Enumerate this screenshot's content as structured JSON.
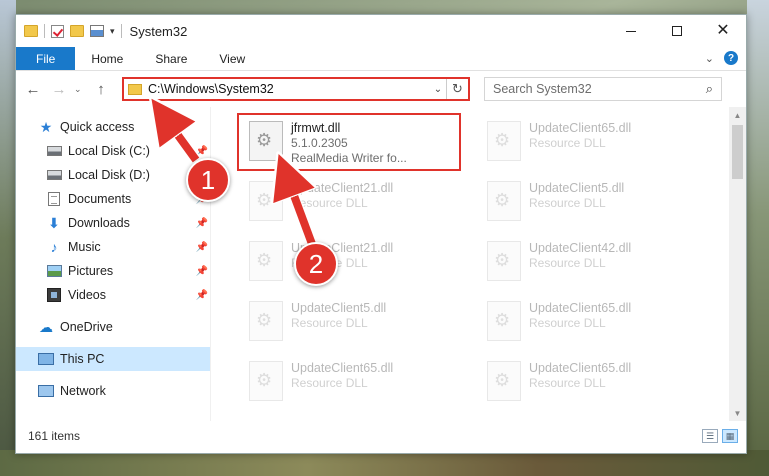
{
  "window": {
    "title": "System32"
  },
  "ribbon": {
    "tabs": [
      "File",
      "Home",
      "Share",
      "View"
    ]
  },
  "nav": {
    "address": "C:\\Windows\\System32",
    "search_placeholder": "Search System32"
  },
  "sidebar": {
    "items": [
      {
        "label": "Quick access",
        "icon": "star-icon"
      },
      {
        "label": "Local Disk (C:)",
        "icon": "disk-icon"
      },
      {
        "label": "Local Disk (D:)",
        "icon": "disk-icon"
      },
      {
        "label": "Documents",
        "icon": "documents-icon"
      },
      {
        "label": "Downloads",
        "icon": "downloads-icon"
      },
      {
        "label": "Music",
        "icon": "music-icon"
      },
      {
        "label": "Pictures",
        "icon": "pictures-icon"
      },
      {
        "label": "Videos",
        "icon": "videos-icon"
      },
      {
        "label": "OneDrive",
        "icon": "cloud-icon"
      },
      {
        "label": "This PC",
        "icon": "pc-icon"
      },
      {
        "label": "Network",
        "icon": "network-icon"
      }
    ]
  },
  "files": {
    "highlighted": {
      "name": "jfrmwt.dll",
      "version": "5.1.0.2305",
      "description": "RealMedia Writer fo..."
    },
    "left_column": [
      {
        "name": "UpdateClient21.dll",
        "desc": "Resource DLL"
      },
      {
        "name": "UpdateClient21.dll",
        "desc": "Resource DLL"
      },
      {
        "name": "UpdateClient5.dll",
        "desc": "Resource DLL"
      },
      {
        "name": "UpdateClient65.dll",
        "desc": "Resource DLL"
      }
    ],
    "right_column": [
      {
        "name": "UpdateClient65.dll",
        "desc": "Resource DLL"
      },
      {
        "name": "UpdateClient5.dll",
        "desc": "Resource DLL"
      },
      {
        "name": "UpdateClient42.dll",
        "desc": "Resource DLL"
      },
      {
        "name": "UpdateClient65.dll",
        "desc": "Resource DLL"
      },
      {
        "name": "UpdateClient65.dll",
        "desc": "Resource DLL"
      }
    ]
  },
  "status": {
    "count": "161 items"
  },
  "annotations": {
    "step1": "1",
    "step2": "2",
    "color": "#e0332b"
  }
}
